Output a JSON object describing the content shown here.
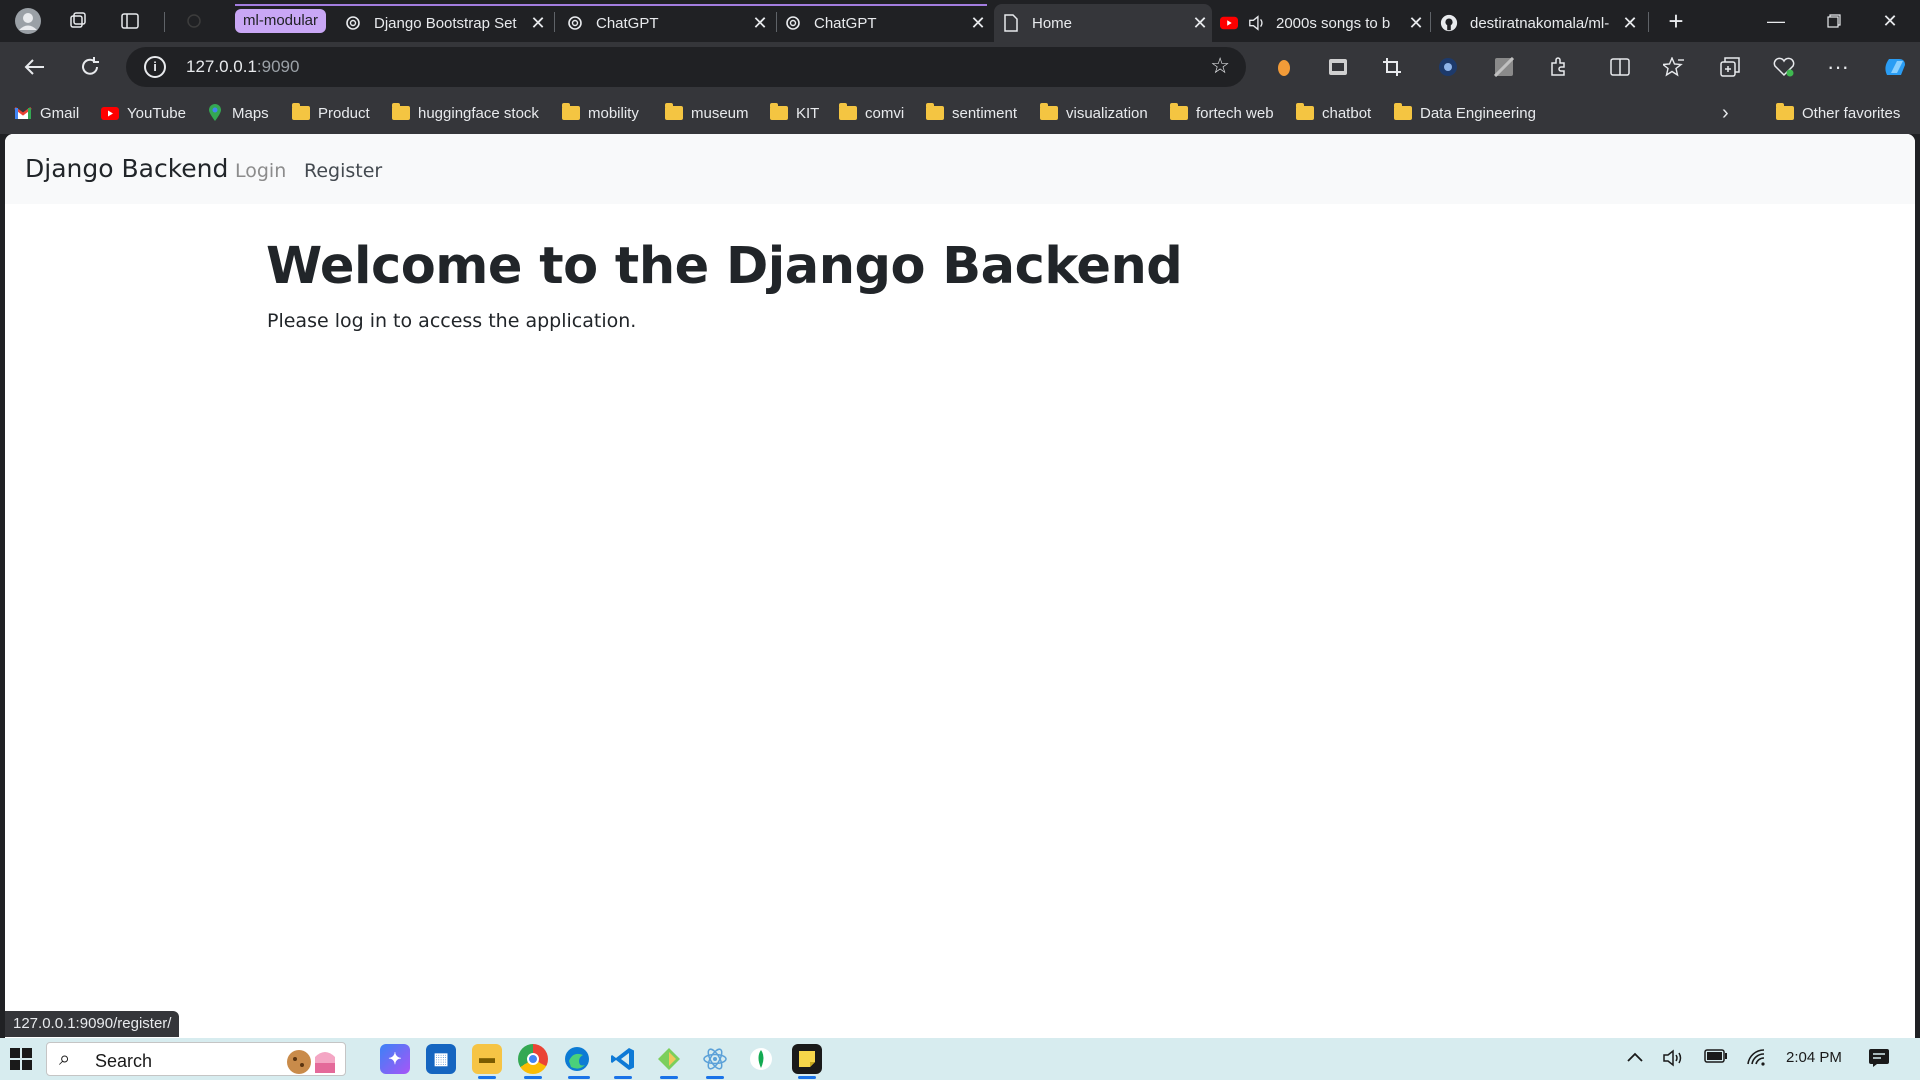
{
  "browser": {
    "tab_group": "ml-modular",
    "tabs": [
      {
        "title": "Django Bootstrap Set"
      },
      {
        "title": "ChatGPT"
      },
      {
        "title": "ChatGPT"
      },
      {
        "title": "Home"
      },
      {
        "title": "2000s songs to b"
      },
      {
        "title": "destiratnakomala/ml-"
      }
    ],
    "url_host": "127.0.0.1",
    "url_port": ":9090",
    "bookmarks": [
      "Gmail",
      "YouTube",
      "Maps",
      "Product",
      "huggingface stock",
      "mobility",
      "museum",
      "KIT",
      "comvi",
      "sentiment",
      "visualization",
      "fortech web",
      "chatbot",
      "Data Engineering"
    ],
    "other_favorites": "Other favorites",
    "status_url": "127.0.0.1:9090/register/"
  },
  "site": {
    "brand": "Django Backend",
    "nav": {
      "login": "Login",
      "register": "Register"
    },
    "headline": "Welcome to the Django Backend",
    "lead": "Please log in to access the application."
  },
  "taskbar": {
    "search_label": "Search",
    "time": "2:04 PM"
  },
  "colors": {
    "group_chip": "#c9a7f5",
    "navbar_bg": "#f8f9fa",
    "text_dark": "#212529",
    "nav_muted": "#8c8c8c",
    "taskbar_bg": "#d7ecef"
  }
}
